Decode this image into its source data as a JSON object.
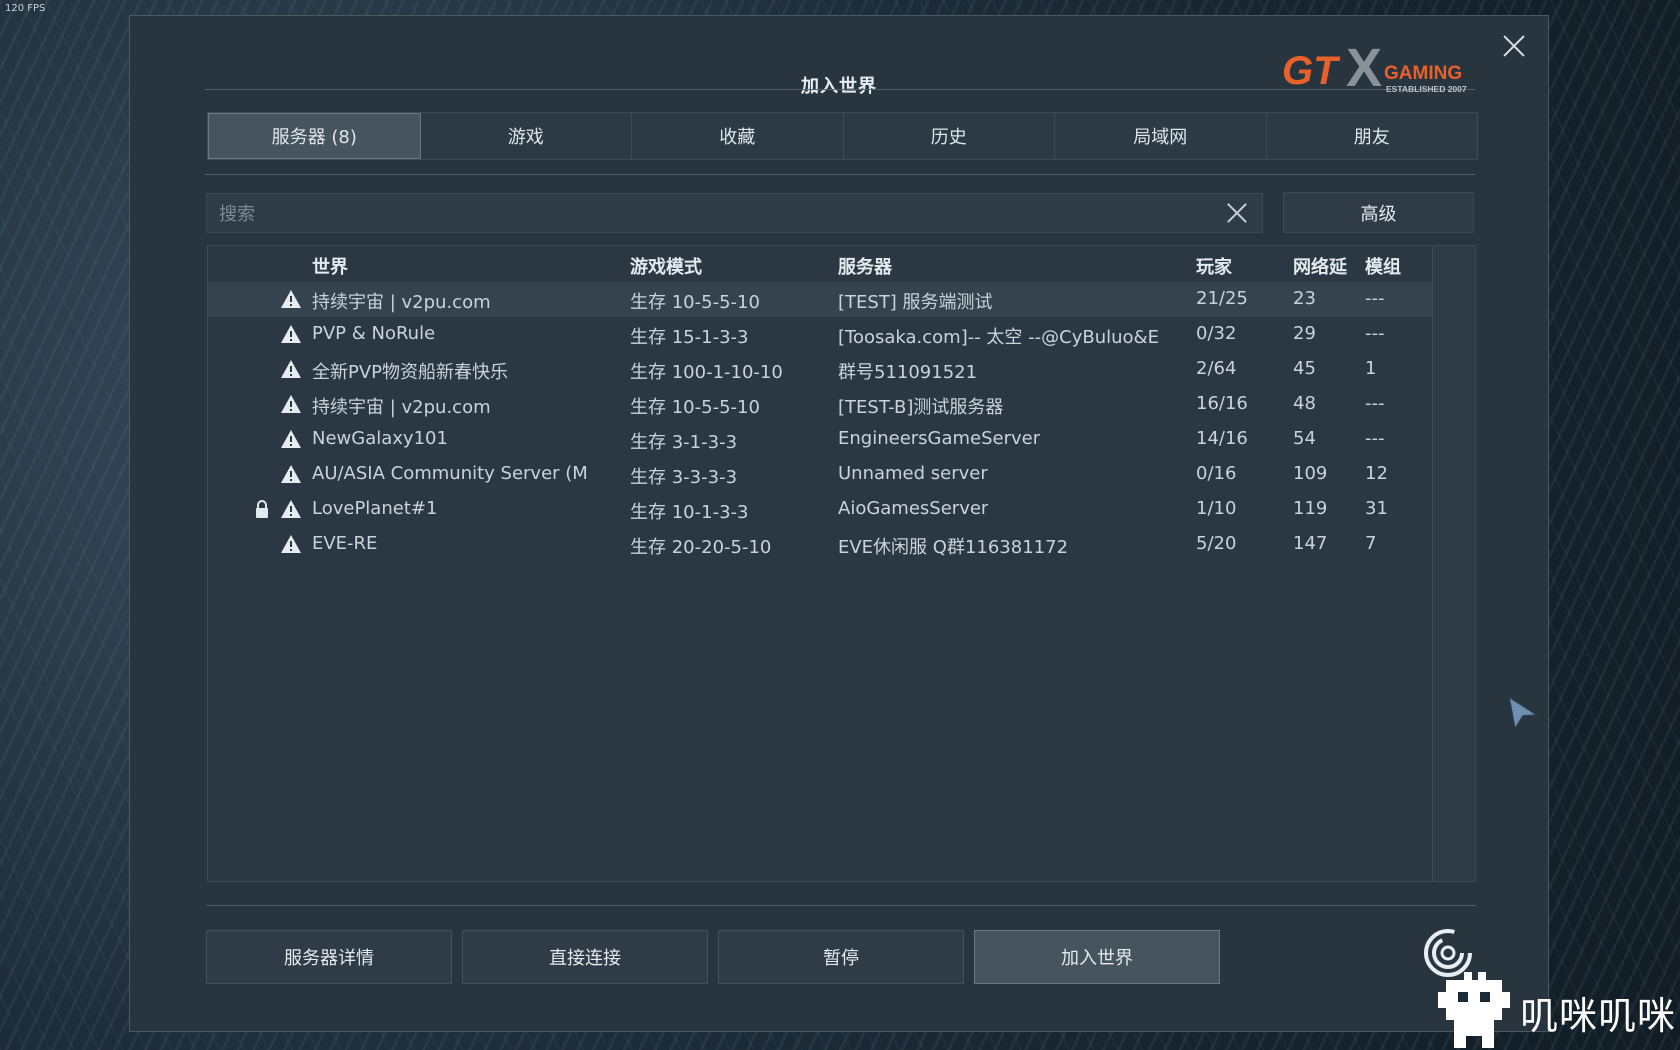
{
  "overlay": {
    "fps": "120 FPS"
  },
  "dialog": {
    "title": "加入世界",
    "logo": {
      "main": "GT",
      "x": "X",
      "sub": "GAMING",
      "tagline": "ESTABLISHED 2007",
      "accent": "#e8602a"
    },
    "tabs": [
      {
        "label": "服务器 (8)",
        "active": true
      },
      {
        "label": "游戏",
        "active": false
      },
      {
        "label": "收藏",
        "active": false
      },
      {
        "label": "历史",
        "active": false
      },
      {
        "label": "局域网",
        "active": false
      },
      {
        "label": "朋友",
        "active": false
      }
    ],
    "search": {
      "placeholder": "搜索",
      "value": ""
    },
    "advanced_label": "高级",
    "columns": {
      "world": "世界",
      "mode": "游戏模式",
      "server": "服务器",
      "players": "玩家",
      "ping": "网络延",
      "mods": "模组"
    },
    "rows": [
      {
        "locked": false,
        "world": "持续宇宙 | v2pu.com",
        "mode": "生存 10-5-5-10",
        "server": "[TEST] 服务端测试",
        "players": "21/25",
        "ping": "23",
        "mods": "---"
      },
      {
        "locked": false,
        "world": "PVP & NoRule",
        "mode": "生存 15-1-3-3",
        "server": "[Toosaka.com]-- 太空 --@CyBuluo&E",
        "players": "0/32",
        "ping": "29",
        "mods": "---"
      },
      {
        "locked": false,
        "world": "全新PVP物资船新春快乐",
        "mode": "生存 100-1-10-10",
        "server": "群号511091521",
        "players": "2/64",
        "ping": "45",
        "mods": "1"
      },
      {
        "locked": false,
        "world": "持续宇宙 | v2pu.com",
        "mode": "生存 10-5-5-10",
        "server": "[TEST-B]测试服务器",
        "players": "16/16",
        "ping": "48",
        "mods": "---"
      },
      {
        "locked": false,
        "world": "NewGalaxy101",
        "mode": "生存 3-1-3-3",
        "server": "EngineersGameServer",
        "players": "14/16",
        "ping": "54",
        "mods": "---"
      },
      {
        "locked": false,
        "world": "AU/ASIA Community Server (M",
        "mode": "生存 3-3-3-3",
        "server": "Unnamed server",
        "players": "0/16",
        "ping": "109",
        "mods": "12"
      },
      {
        "locked": true,
        "world": "LovePlanet#1",
        "mode": "生存 10-1-3-3",
        "server": "AioGamesServer",
        "players": "1/10",
        "ping": "119",
        "mods": "31"
      },
      {
        "locked": false,
        "world": "EVE-RE",
        "mode": "生存 20-20-5-10",
        "server": "EVE休闲服 Q群116381172",
        "players": "5/20",
        "ping": "147",
        "mods": "7"
      }
    ],
    "buttons": {
      "details": "服务器详情",
      "direct": "直接连接",
      "pause": "暂停",
      "join": "加入世界"
    }
  },
  "watermark": {
    "text": "叽咪叽咪"
  }
}
